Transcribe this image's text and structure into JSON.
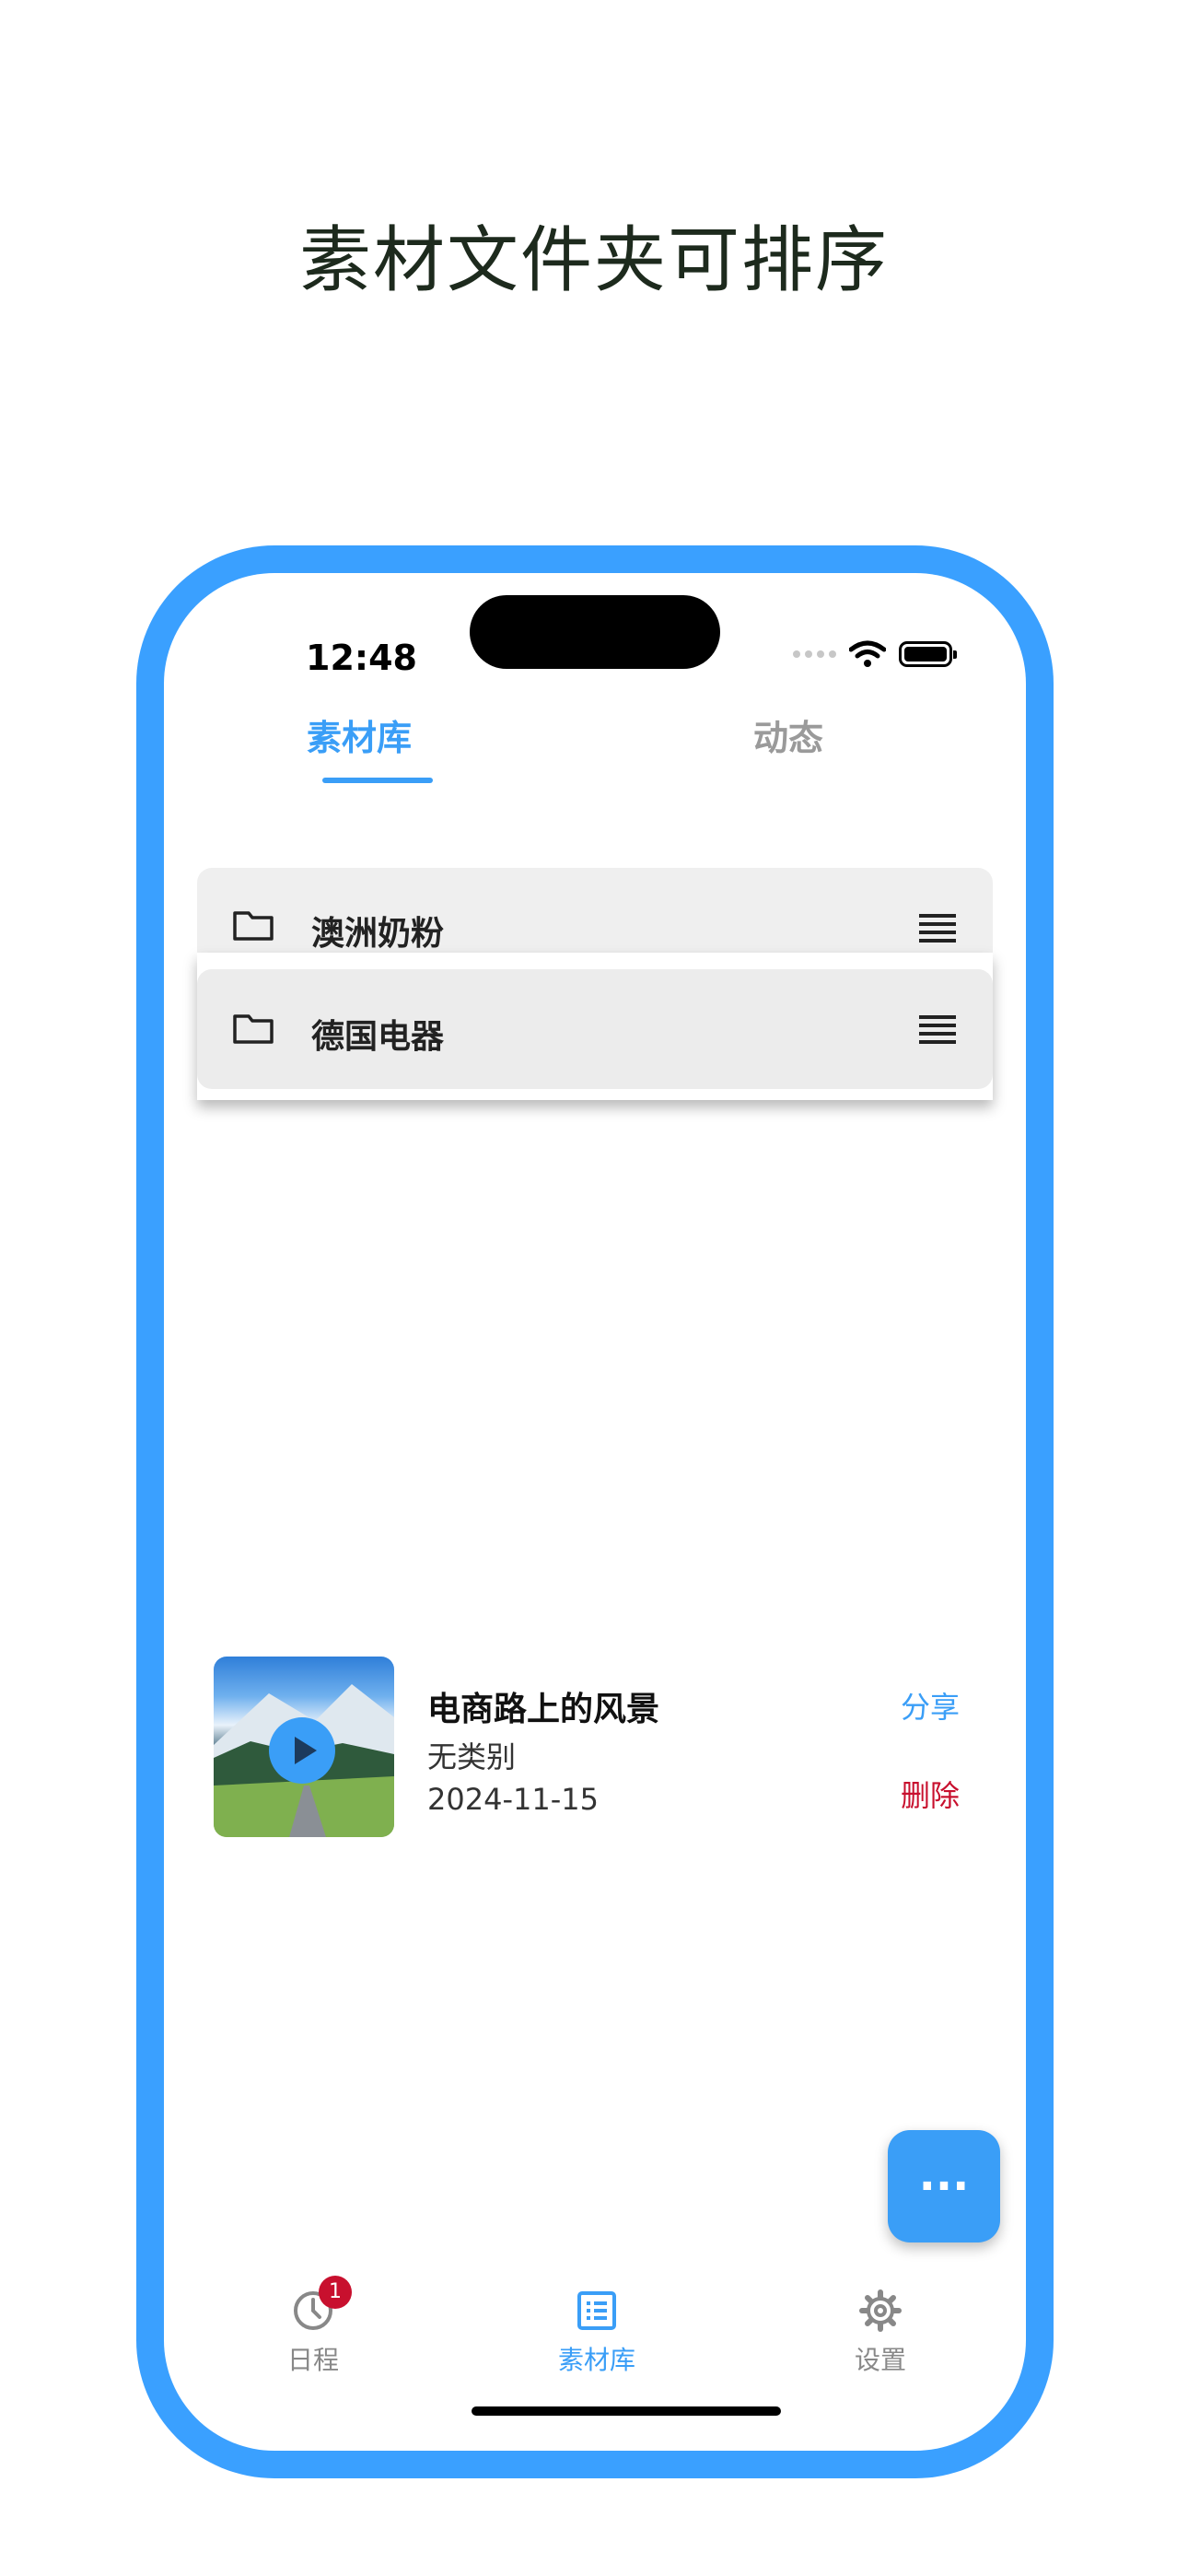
{
  "headline": "素材文件夹可排序",
  "status_bar": {
    "time": "12:48"
  },
  "tabs": [
    {
      "label": "素材库",
      "active": true
    },
    {
      "label": "动态",
      "active": false
    }
  ],
  "folders": [
    {
      "label": "澳洲奶粉",
      "state": "behind"
    },
    {
      "label": "德国电器",
      "state": "dragging"
    }
  ],
  "media_item": {
    "title": "电商路上的风景",
    "category": "无类别",
    "date": "2024-11-15",
    "share_label": "分享",
    "delete_label": "删除"
  },
  "fab": {
    "icon": "more-dots-icon",
    "label": "···"
  },
  "bottom_nav": [
    {
      "label": "日程",
      "icon": "clock-icon",
      "badge": "1",
      "active": false
    },
    {
      "label": "素材库",
      "icon": "list-icon",
      "active": true
    },
    {
      "label": "设置",
      "icon": "gear-icon",
      "active": false
    }
  ],
  "colors": {
    "accent": "#3a9ef7",
    "delete": "#c8102e",
    "badge": "#c8102e",
    "phone_frame": "#3aa0ff",
    "headline": "#1d2a1d"
  }
}
